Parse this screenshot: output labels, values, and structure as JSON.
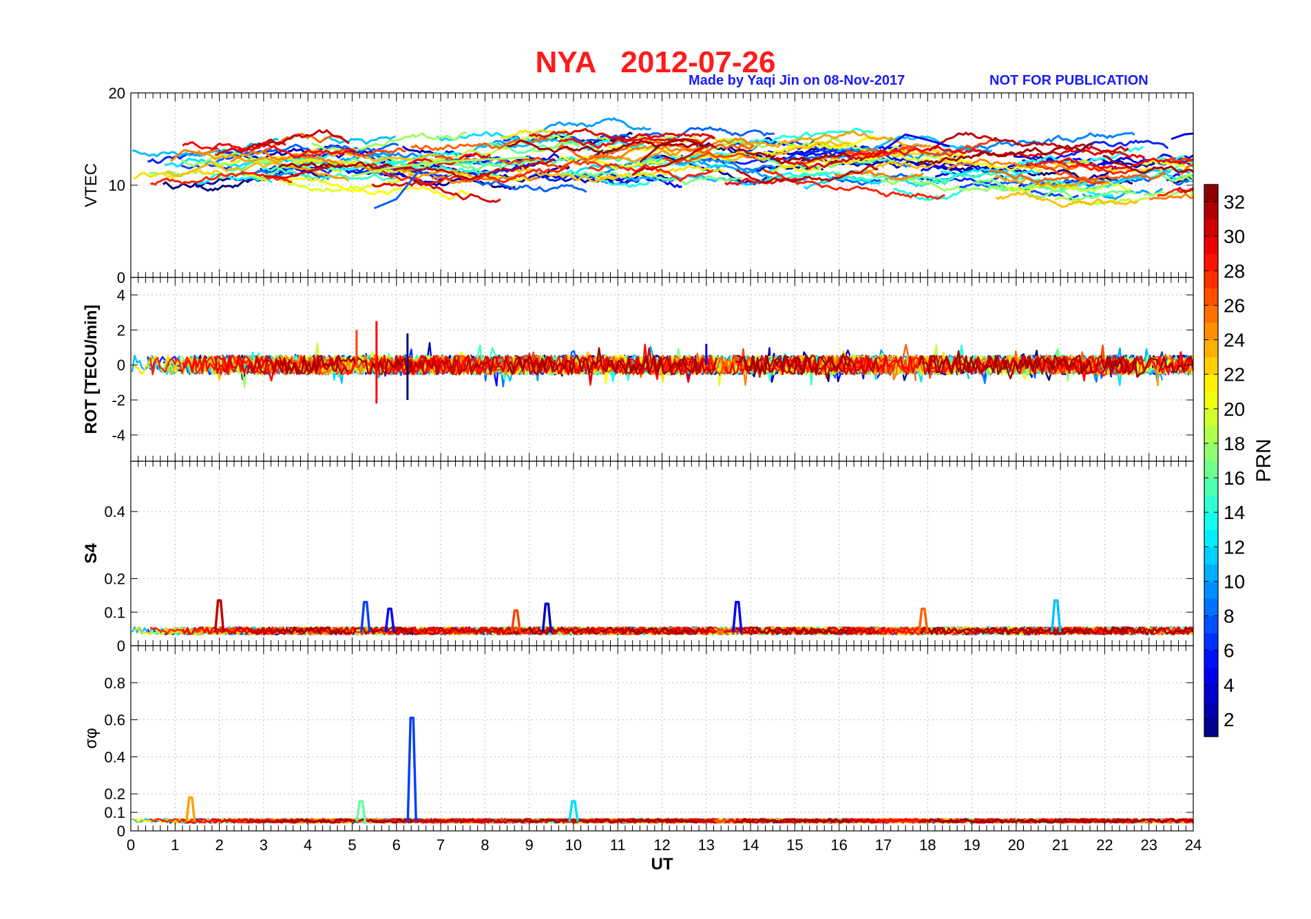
{
  "header": {
    "title": "NYA   2012-07-26",
    "credit": "Made by Yaqi Jin on 08-Nov-2017",
    "notice": "NOT FOR PUBLICATION"
  },
  "colors": {
    "title": "#ff1a1a",
    "credit": "#1a1aff",
    "colormap": "jet"
  },
  "chart_data": [
    {
      "type": "line",
      "panel": "VTEC",
      "ylabel": "VTEC",
      "ylim": [
        0,
        20
      ],
      "yticks": [
        "0",
        "10",
        "20"
      ],
      "xlim": [
        0,
        24
      ],
      "grid": true,
      "typical_range": [
        7,
        16
      ],
      "series": [
        {
          "prn": 5,
          "x": [
            17.0,
            17.5,
            18.0,
            18.5
          ],
          "y": [
            13.8,
            15.5,
            14.9,
            14.2
          ]
        },
        {
          "prn": 4,
          "x": [
            23.5,
            23.8,
            24.0
          ],
          "y": [
            15.0,
            15.5,
            15.6
          ]
        },
        {
          "prn": 32,
          "x": [
            11.5,
            12.0,
            12.5,
            13.0
          ],
          "y": [
            12.5,
            14.5,
            15.0,
            14.2
          ]
        },
        {
          "prn": 25,
          "x": [
            0.9,
            1.2,
            1.6,
            2.0
          ],
          "y": [
            12.6,
            13.8,
            13.4,
            13.9
          ]
        },
        {
          "prn": 18,
          "x": [
            5.0,
            6.0,
            7.0,
            8.0,
            9.0
          ],
          "y": [
            11.0,
            12.0,
            12.5,
            12.8,
            13.0
          ]
        },
        {
          "prn": 8,
          "x": [
            5.5,
            6.0,
            6.5
          ],
          "y": [
            7.5,
            8.5,
            11.5
          ]
        },
        {
          "prn": 30,
          "x": [
            3.0,
            3.5,
            4.0,
            4.5
          ],
          "y": [
            11.0,
            10.8,
            11.5,
            12.0
          ]
        }
      ]
    },
    {
      "type": "line",
      "panel": "ROT",
      "ylabel": "ROT [TECU/min]",
      "ylim": [
        -5.5,
        5
      ],
      "yticks": [
        "-4",
        "-2",
        "0",
        "2",
        "4"
      ],
      "xlim": [
        0,
        24
      ],
      "grid": true,
      "notable_spikes": [
        {
          "x": 5.1,
          "y": 2.0
        },
        {
          "x": 5.55,
          "y": 2.5
        },
        {
          "x": 5.55,
          "y": -2.2
        },
        {
          "x": 6.25,
          "y": 1.8
        },
        {
          "x": 6.25,
          "y": -2.0
        },
        {
          "x": 13.0,
          "y": 1.2
        },
        {
          "x": 23.2,
          "y": -1.2
        }
      ],
      "typical_range": [
        -1,
        1
      ]
    },
    {
      "type": "line",
      "panel": "S4",
      "ylabel": "S4",
      "ylim": [
        0,
        0.55
      ],
      "yticks": [
        "0",
        "0.1",
        "0.2",
        "0.4"
      ],
      "xlim": [
        0,
        24
      ],
      "grid": true,
      "notable_peaks": [
        {
          "x": 2.0,
          "y": 0.135,
          "prn": 31
        },
        {
          "x": 5.3,
          "y": 0.13,
          "prn": 7
        },
        {
          "x": 5.85,
          "y": 0.11,
          "prn": 5
        },
        {
          "x": 8.7,
          "y": 0.105,
          "prn": 27
        },
        {
          "x": 9.4,
          "y": 0.125,
          "prn": 3
        },
        {
          "x": 13.7,
          "y": 0.13,
          "prn": 5
        },
        {
          "x": 17.9,
          "y": 0.11,
          "prn": 26
        },
        {
          "x": 20.9,
          "y": 0.135,
          "prn": 11
        }
      ],
      "baseline": 0.04
    },
    {
      "type": "line",
      "panel": "sigma_phi",
      "ylabel": "σφ",
      "ylim": [
        0,
        1
      ],
      "yticks": [
        "0",
        "0.1",
        "0.2",
        "0.4",
        "0.6",
        "0.8"
      ],
      "xlim": [
        0,
        24
      ],
      "xticks": [
        "0",
        "1",
        "2",
        "3",
        "4",
        "5",
        "6",
        "7",
        "8",
        "9",
        "10",
        "11",
        "12",
        "13",
        "14",
        "15",
        "16",
        "17",
        "18",
        "19",
        "20",
        "21",
        "22",
        "23",
        "24"
      ],
      "xlabel": "UT",
      "grid": true,
      "notable_peaks": [
        {
          "x": 6.35,
          "y": 0.61,
          "prn": 7
        },
        {
          "x": 1.35,
          "y": 0.18,
          "prn": 24
        },
        {
          "x": 5.2,
          "y": 0.16,
          "prn": 16
        },
        {
          "x": 10.0,
          "y": 0.16,
          "prn": 12
        }
      ],
      "baseline": 0.05
    }
  ],
  "colorbar": {
    "label": "PRN",
    "range": [
      1,
      33
    ],
    "ticks": [
      "2",
      "4",
      "6",
      "8",
      "10",
      "12",
      "14",
      "16",
      "18",
      "20",
      "22",
      "24",
      "26",
      "28",
      "30",
      "32"
    ]
  }
}
